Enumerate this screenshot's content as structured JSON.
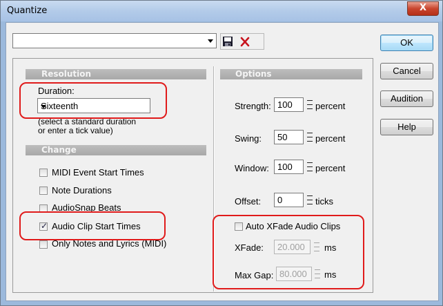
{
  "window": {
    "title": "Quantize",
    "close_glyph": "X"
  },
  "preset": {
    "value": ""
  },
  "buttons": {
    "ok": "OK",
    "cancel": "Cancel",
    "audition": "Audition",
    "help": "Help"
  },
  "resolution": {
    "header": "Resolution",
    "duration_label": "Duration:",
    "duration_value": "Sixteenth",
    "hint_line1": "(select a standard duration",
    "hint_line2": "or enter a tick value)"
  },
  "change": {
    "header": "Change",
    "items": [
      {
        "label": "MIDI Event Start Times",
        "checked": false
      },
      {
        "label": "Note Durations",
        "checked": false
      },
      {
        "label": "AudioSnap Beats",
        "checked": false
      },
      {
        "label": "Audio Clip Start Times",
        "checked": true
      },
      {
        "label": "Only Notes and Lyrics (MIDI)",
        "checked": false
      }
    ]
  },
  "options": {
    "header": "Options",
    "strength": {
      "label": "Strength:",
      "value": "100",
      "unit": "percent"
    },
    "swing": {
      "label": "Swing:",
      "value": "50",
      "unit": "percent"
    },
    "window": {
      "label": "Window:",
      "value": "100",
      "unit": "percent"
    },
    "offset": {
      "label": "Offset:",
      "value": "0",
      "unit": "ticks"
    },
    "auto_xfade": {
      "label": "Auto XFade Audio Clips",
      "checked": false
    },
    "xfade": {
      "label": "XFade:",
      "value": "20.000",
      "unit": "ms"
    },
    "max_gap": {
      "label": "Max Gap:",
      "value": "80.000",
      "unit": "ms"
    }
  },
  "colors": {
    "highlight": "#e01a1a",
    "section_header": "#aaaaaa",
    "title_bar": "#b9d1ea"
  }
}
